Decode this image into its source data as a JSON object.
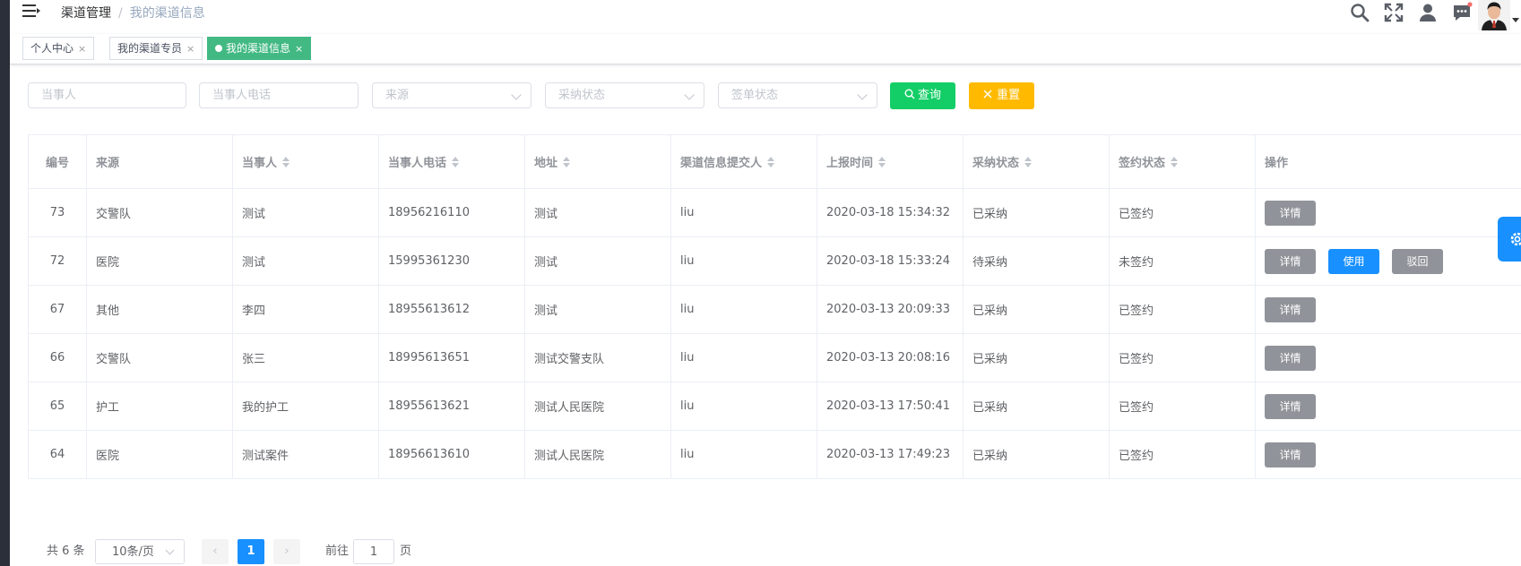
{
  "breadcrumb": {
    "level1": "渠道管理",
    "separator": "/",
    "level2": "我的渠道信息"
  },
  "tags": [
    {
      "label": "个人中心",
      "close": "×"
    },
    {
      "label": "我的渠道专员",
      "close": "×"
    },
    {
      "label": "我的渠道信息",
      "close": "×"
    }
  ],
  "filters": {
    "party_placeholder": "当事人",
    "phone_placeholder": "当事人电话",
    "source_placeholder": "来源",
    "adopt_placeholder": "采纳状态",
    "sign_placeholder": "签单状态",
    "query_label": "查询",
    "reset_label": "重置"
  },
  "table": {
    "headers": [
      "编号",
      "来源",
      "当事人",
      "当事人电话",
      "地址",
      "渠道信息提交人",
      "上报时间",
      "采纳状态",
      "签约状态",
      "操作"
    ],
    "rows": [
      {
        "id": "73",
        "source": "交警队",
        "party": "测试",
        "phone": "18956216110",
        "address": "测试",
        "submitter": "liu",
        "time": "2020-03-18 15:34:32",
        "adopt": "已采纳",
        "sign": "已签约",
        "actions": [
          "详情"
        ]
      },
      {
        "id": "72",
        "source": "医院",
        "party": "测试",
        "phone": "15995361230",
        "address": "测试",
        "submitter": "liu",
        "time": "2020-03-18 15:33:24",
        "adopt": "待采纳",
        "sign": "未签约",
        "actions": [
          "详情",
          "使用",
          "驳回"
        ]
      },
      {
        "id": "67",
        "source": "其他",
        "party": "李四",
        "phone": "18955613612",
        "address": "测试",
        "submitter": "liu",
        "time": "2020-03-13 20:09:33",
        "adopt": "已采纳",
        "sign": "已签约",
        "actions": [
          "详情"
        ]
      },
      {
        "id": "66",
        "source": "交警队",
        "party": "张三",
        "phone": "18995613651",
        "address": "测试交警支队",
        "submitter": "liu",
        "time": "2020-03-13 20:08:16",
        "adopt": "已采纳",
        "sign": "已签约",
        "actions": [
          "详情"
        ]
      },
      {
        "id": "65",
        "source": "护工",
        "party": "我的护工",
        "phone": "18955613621",
        "address": "测试人民医院",
        "submitter": "liu",
        "time": "2020-03-13 17:50:41",
        "adopt": "已采纳",
        "sign": "已签约",
        "actions": [
          "详情"
        ]
      },
      {
        "id": "64",
        "source": "医院",
        "party": "测试案件",
        "phone": "18956613610",
        "address": "测试人民医院",
        "submitter": "liu",
        "time": "2020-03-13 17:49:23",
        "adopt": "已采纳",
        "sign": "已签约",
        "actions": [
          "详情"
        ]
      }
    ]
  },
  "pagination": {
    "total_label": "共 6 条",
    "page_size": "10条/页",
    "current_page": "1",
    "goto_label": "前往",
    "goto_value": "1",
    "page_suffix": "页",
    "prev": "‹",
    "next": "›"
  },
  "colors": {
    "primary": "#1890ff",
    "success": "#13ce66",
    "warning": "#ffba00",
    "info": "#909399",
    "tag_active": "#42b983"
  }
}
